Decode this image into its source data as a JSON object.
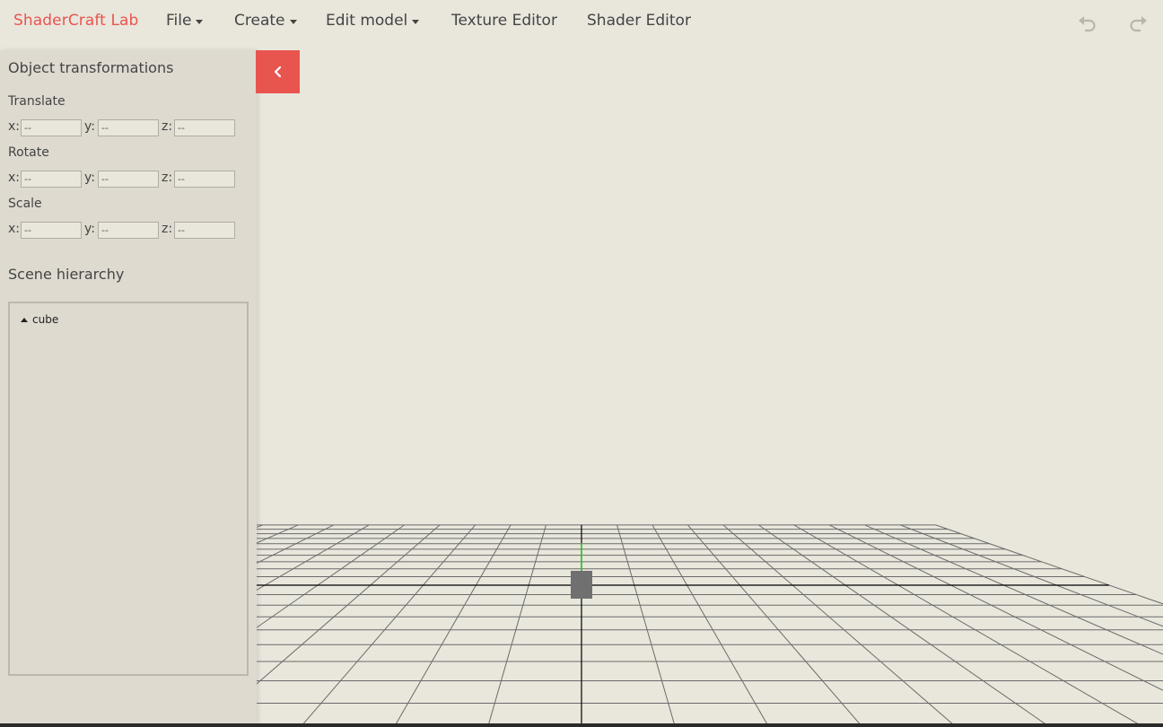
{
  "app": {
    "brand": "ShaderCraft Lab"
  },
  "menu": {
    "file": "File",
    "create": "Create",
    "edit_model": "Edit model",
    "texture_editor": "Texture Editor",
    "shader_editor": "Shader Editor"
  },
  "toolbar": {
    "undo_icon": "undo-icon",
    "redo_icon": "redo-icon"
  },
  "sidebar": {
    "transform_title": "Object transformations",
    "translate": {
      "label": "Translate",
      "x_label": "x:",
      "y_label": "y:",
      "z_label": "z:",
      "x_placeholder": "--",
      "y_placeholder": "--",
      "z_placeholder": "--"
    },
    "rotate": {
      "label": "Rotate",
      "x_label": "x:",
      "y_label": "y:",
      "z_label": "z:",
      "x_placeholder": "--",
      "y_placeholder": "--",
      "z_placeholder": "--"
    },
    "scale": {
      "label": "Scale",
      "x_label": "x:",
      "y_label": "y:",
      "z_label": "z:",
      "x_placeholder": "--",
      "y_placeholder": "--",
      "z_placeholder": "--"
    },
    "hierarchy_title": "Scene hierarchy",
    "hierarchy_items": [
      {
        "label": "cube",
        "expanded": true
      }
    ],
    "collapse_icon": "chevron-left-icon"
  },
  "viewport": {
    "grid": {
      "divisions": 20
    },
    "colors": {
      "background": "#e9e6dc",
      "grid_line": "#6b6b6b",
      "axis_line": "#000000",
      "y_axis": "#22cc22",
      "object": "#707070",
      "accent": "#e8554e"
    }
  }
}
